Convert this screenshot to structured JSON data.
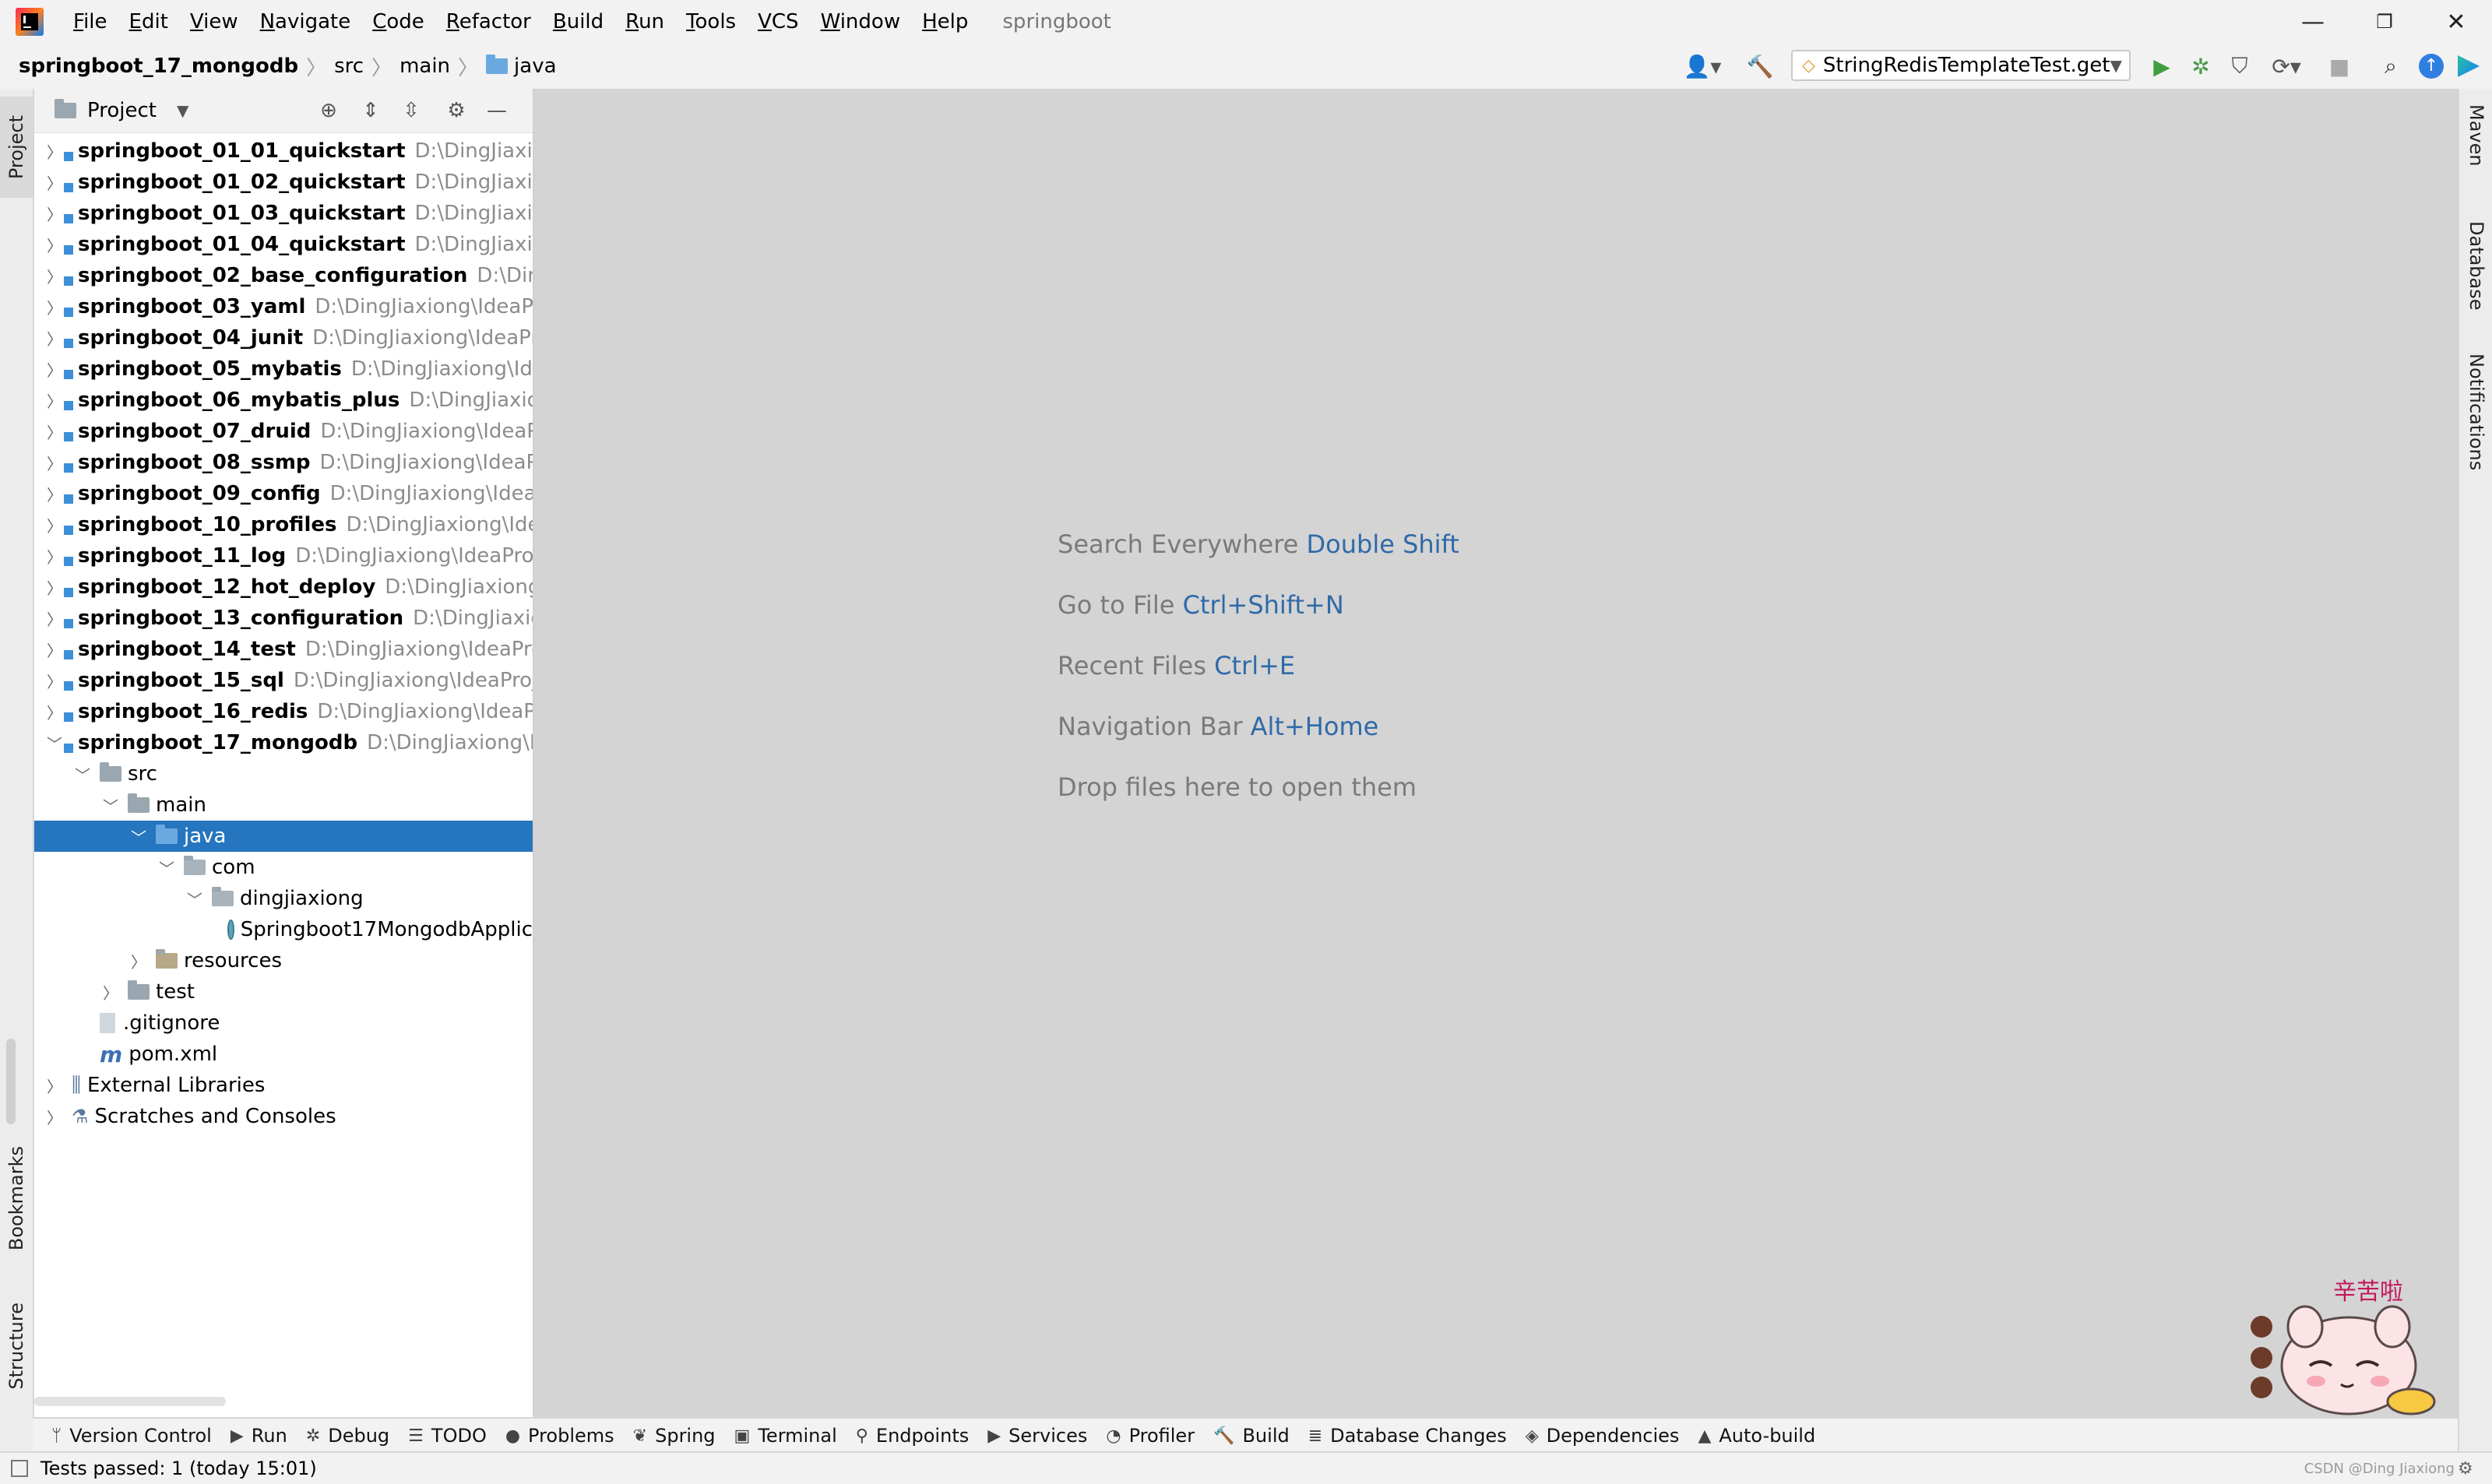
{
  "menubar": {
    "items": [
      "File",
      "Edit",
      "View",
      "Navigate",
      "Code",
      "Refactor",
      "Build",
      "Run",
      "Tools",
      "VCS",
      "Window",
      "Help"
    ],
    "window_title": "springboot"
  },
  "navbar": {
    "breadcrumb": [
      "springboot_17_mongodb",
      "src",
      "main",
      "java"
    ],
    "run_config": "StringRedisTemplateTest.get"
  },
  "left_tabs": {
    "project": "Project",
    "bookmarks": "Bookmarks",
    "structure": "Structure"
  },
  "right_tabs": {
    "maven": "Maven",
    "database": "Database",
    "notifications": "Notifications"
  },
  "project_panel": {
    "title": "Project",
    "tree": [
      {
        "name": "springboot_01_01_quickstart",
        "path": "D:\\DingJiaxiong\\",
        "bold": true,
        "depth": 0,
        "expanded": false,
        "type": "module"
      },
      {
        "name": "springboot_01_02_quickstart",
        "path": "D:\\DingJiaxiong\\",
        "bold": true,
        "depth": 0,
        "expanded": false,
        "type": "module"
      },
      {
        "name": "springboot_01_03_quickstart",
        "path": "D:\\DingJiaxiong\\",
        "bold": true,
        "depth": 0,
        "expanded": false,
        "type": "module"
      },
      {
        "name": "springboot_01_04_quickstart",
        "path": "D:\\DingJiaxiong\\",
        "bold": true,
        "depth": 0,
        "expanded": false,
        "type": "module"
      },
      {
        "name": "springboot_02_base_configuration",
        "path": "D:\\DingJia",
        "bold": true,
        "depth": 0,
        "expanded": false,
        "type": "module"
      },
      {
        "name": "springboot_03_yaml",
        "path": "D:\\DingJiaxiong\\IdeaProje",
        "bold": true,
        "depth": 0,
        "expanded": false,
        "type": "module"
      },
      {
        "name": "springboot_04_junit",
        "path": "D:\\DingJiaxiong\\IdeaProje",
        "bold": true,
        "depth": 0,
        "expanded": false,
        "type": "module"
      },
      {
        "name": "springboot_05_mybatis",
        "path": "D:\\DingJiaxiong\\IdeaPr",
        "bold": true,
        "depth": 0,
        "expanded": false,
        "type": "module"
      },
      {
        "name": "springboot_06_mybatis_plus",
        "path": "D:\\DingJiaxiong\\I",
        "bold": true,
        "depth": 0,
        "expanded": false,
        "type": "module"
      },
      {
        "name": "springboot_07_druid",
        "path": "D:\\DingJiaxiong\\IdeaProje",
        "bold": true,
        "depth": 0,
        "expanded": false,
        "type": "module"
      },
      {
        "name": "springboot_08_ssmp",
        "path": "D:\\DingJiaxiong\\IdeaProje",
        "bold": true,
        "depth": 0,
        "expanded": false,
        "type": "module"
      },
      {
        "name": "springboot_09_config",
        "path": "D:\\DingJiaxiong\\IdeaPro",
        "bold": true,
        "depth": 0,
        "expanded": false,
        "type": "module"
      },
      {
        "name": "springboot_10_profiles",
        "path": "D:\\DingJiaxiong\\IdeaPr",
        "bold": true,
        "depth": 0,
        "expanded": false,
        "type": "module"
      },
      {
        "name": "springboot_11_log",
        "path": "D:\\DingJiaxiong\\IdeaProject",
        "bold": true,
        "depth": 0,
        "expanded": false,
        "type": "module"
      },
      {
        "name": "springboot_12_hot_deploy",
        "path": "D:\\DingJiaxiong\\Ide",
        "bold": true,
        "depth": 0,
        "expanded": false,
        "type": "module"
      },
      {
        "name": "springboot_13_configuration",
        "path": "D:\\DingJiaxiong\\",
        "bold": true,
        "depth": 0,
        "expanded": false,
        "type": "module"
      },
      {
        "name": "springboot_14_test",
        "path": "D:\\DingJiaxiong\\IdeaProjec",
        "bold": true,
        "depth": 0,
        "expanded": false,
        "type": "module"
      },
      {
        "name": "springboot_15_sql",
        "path": "D:\\DingJiaxiong\\IdeaProject",
        "bold": true,
        "depth": 0,
        "expanded": false,
        "type": "module"
      },
      {
        "name": "springboot_16_redis",
        "path": "D:\\DingJiaxiong\\IdeaProje",
        "bold": true,
        "depth": 0,
        "expanded": false,
        "type": "module"
      },
      {
        "name": "springboot_17_mongodb",
        "path": "D:\\DingJiaxiong\\Idea",
        "bold": true,
        "depth": 0,
        "expanded": true,
        "type": "module"
      },
      {
        "name": "src",
        "path": "",
        "bold": false,
        "depth": 1,
        "expanded": true,
        "type": "folder"
      },
      {
        "name": "main",
        "path": "",
        "bold": false,
        "depth": 2,
        "expanded": true,
        "type": "folder"
      },
      {
        "name": "java",
        "path": "",
        "bold": false,
        "depth": 3,
        "expanded": true,
        "type": "folder-blue",
        "selected": true
      },
      {
        "name": "com",
        "path": "",
        "bold": false,
        "depth": 4,
        "expanded": true,
        "type": "package"
      },
      {
        "name": "dingjiaxiong",
        "path": "",
        "bold": false,
        "depth": 5,
        "expanded": true,
        "type": "package"
      },
      {
        "name": "Springboot17MongodbApplic",
        "path": "",
        "bold": false,
        "depth": 6,
        "expanded": null,
        "type": "spring-class"
      },
      {
        "name": "resources",
        "path": "",
        "bold": false,
        "depth": 3,
        "expanded": false,
        "type": "resources"
      },
      {
        "name": "test",
        "path": "",
        "bold": false,
        "depth": 2,
        "expanded": false,
        "type": "folder"
      },
      {
        "name": ".gitignore",
        "path": "",
        "bold": false,
        "depth": 1,
        "expanded": null,
        "type": "file"
      },
      {
        "name": "pom.xml",
        "path": "",
        "bold": false,
        "depth": 1,
        "expanded": null,
        "type": "maven"
      },
      {
        "name": "External Libraries",
        "path": "",
        "bold": false,
        "depth": 0,
        "expanded": false,
        "type": "libraries"
      },
      {
        "name": "Scratches and Consoles",
        "path": "",
        "bold": false,
        "depth": 0,
        "expanded": false,
        "type": "scratches"
      }
    ]
  },
  "editor_hints": [
    {
      "text": "Search Everywhere",
      "key": "Double Shift"
    },
    {
      "text": "Go to File",
      "key": "Ctrl+Shift+N"
    },
    {
      "text": "Recent Files",
      "key": "Ctrl+E"
    },
    {
      "text": "Navigation Bar",
      "key": "Alt+Home"
    },
    {
      "text": "Drop files here to open them",
      "key": ""
    }
  ],
  "sticker_text": "辛苦啦",
  "bottom_tabs": [
    {
      "label": "Version Control",
      "icon": "version-control-icon"
    },
    {
      "label": "Run",
      "icon": "run-icon"
    },
    {
      "label": "Debug",
      "icon": "debug-icon"
    },
    {
      "label": "TODO",
      "icon": "todo-icon"
    },
    {
      "label": "Problems",
      "icon": "problems-icon"
    },
    {
      "label": "Spring",
      "icon": "spring-icon"
    },
    {
      "label": "Terminal",
      "icon": "terminal-icon"
    },
    {
      "label": "Endpoints",
      "icon": "endpoints-icon"
    },
    {
      "label": "Services",
      "icon": "services-icon"
    },
    {
      "label": "Profiler",
      "icon": "profiler-icon"
    },
    {
      "label": "Build",
      "icon": "build-icon"
    },
    {
      "label": "Database Changes",
      "icon": "database-changes-icon"
    },
    {
      "label": "Dependencies",
      "icon": "dependencies-icon"
    },
    {
      "label": "Auto-build",
      "icon": "auto-build-icon"
    }
  ],
  "status_bar": {
    "message": "Tests passed: 1 (today 15:01)",
    "watermark": "CSDN @Ding Jiaxiong"
  }
}
